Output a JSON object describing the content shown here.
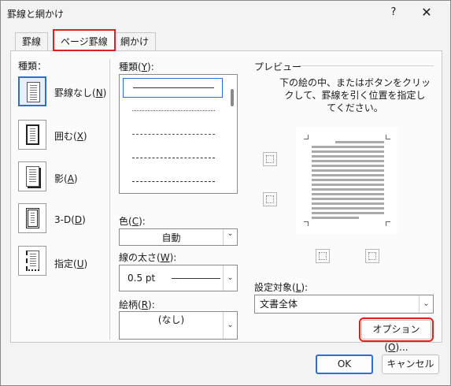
{
  "title": "罫線と網かけ",
  "help_label": "?",
  "close_label": "✕",
  "tabs": [
    {
      "label": "罫線"
    },
    {
      "label": "ページ罫線"
    },
    {
      "label": "網かけ"
    }
  ],
  "setting": {
    "header": "種類：",
    "items": [
      {
        "label": "罫線なし(",
        "key": "N",
        "end": ")"
      },
      {
        "label": "囲む(",
        "key": "X",
        "end": ")"
      },
      {
        "label": "影(",
        "key": "A",
        "end": ")"
      },
      {
        "label": "3-D(",
        "key": "D",
        "end": ")"
      },
      {
        "label": "指定(",
        "key": "U",
        "end": ")"
      }
    ]
  },
  "style": {
    "label": "種類(",
    "key": "Y",
    "end": "):"
  },
  "color": {
    "label": "色(",
    "key": "C",
    "end": "):",
    "value": "自動"
  },
  "width": {
    "label": "線の太さ(",
    "key": "W",
    "end": "):",
    "value": "0.5 pt"
  },
  "art": {
    "label": "絵柄(",
    "key": "R",
    "end": "):",
    "value": "(なし)"
  },
  "preview": {
    "header": "プレビュー",
    "instructions": [
      "下の絵の中、またはボタンをクリッ",
      "クして、罫線を引く位置を指定し",
      "てください。"
    ]
  },
  "apply_to": {
    "label": "設定対象(",
    "key": "L",
    "end": "):",
    "value": "文書全体"
  },
  "options_button": {
    "label": "オプション(",
    "key": "O",
    "end": ")..."
  },
  "ok_button": "OK",
  "cancel_button": "キャンセル",
  "colors": {
    "accent": "#2a6fd6",
    "highlight": "#e0201f"
  }
}
